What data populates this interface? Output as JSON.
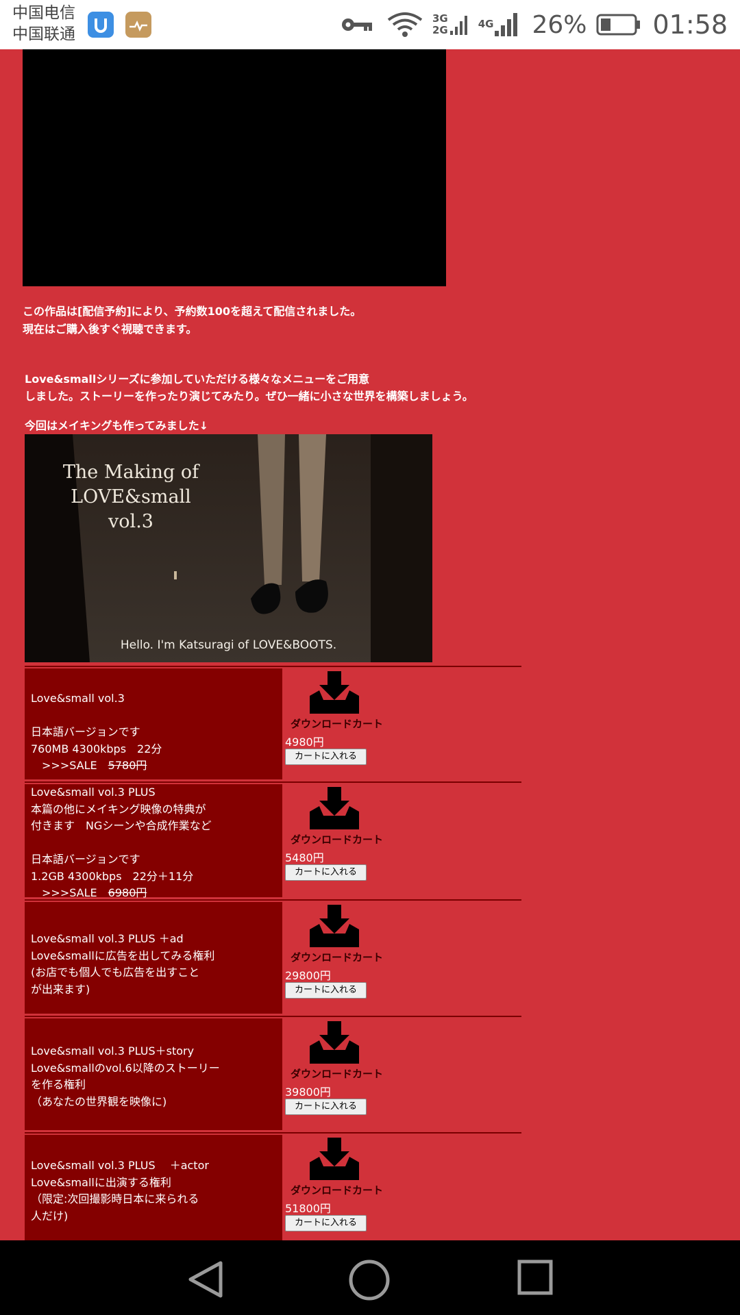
{
  "status_bar": {
    "carrier_1": "中国电信",
    "carrier_2": "中国联通",
    "net_1_top": "3G",
    "net_1_bottom": "2G",
    "net_2": "4G",
    "battery": "26%",
    "time": "01:58",
    "icons": [
      "app-icon-blue",
      "app-icon-gold",
      "key-icon",
      "wifi-icon",
      "signal-icon",
      "signal-icon",
      "battery-icon"
    ]
  },
  "notice": {
    "line1": "この作品は[配信予約]により、予約数100を超えて配信されました。",
    "line2": "現在はご購入後すぐ視聴できます。"
  },
  "intro": {
    "line1": "Love&smallシリーズに参加していただける様々なメニューをご用意",
    "line2": "しました。ストーリーを作ったり演じてみたり。ぜひ一緒に小さな世界を構築しましょう。"
  },
  "making_line": "今回はメイキングも作ってみました↓",
  "hero": {
    "title_1": "The Making of",
    "title_2": "LOVE&small",
    "title_3": "vol.3",
    "caption": "Hello. I'm Katsuragi of LOVE&BOOTS."
  },
  "products": [
    {
      "lines": [
        "Love&small vol.3",
        "",
        "日本語バージョンです",
        "760MB 4300kbps　22分"
      ],
      "sale_prefix": "　>>>SALE　",
      "sale_old": "5780円",
      "download_label": "ダウンロードカート",
      "price": "4980円",
      "button": "カートに入れる"
    },
    {
      "lines": [
        "Love&small vol.3 PLUS",
        "本篇の他にメイキング映像の特典が",
        "付きます　NGシーンや合成作業など",
        "",
        "日本語バージョンです",
        "1.2GB 4300kbps　22分＋11分"
      ],
      "sale_prefix": "　>>>SALE　",
      "sale_old": "6980円",
      "download_label": "ダウンロードカート",
      "price": "5480円",
      "button": "カートに入れる"
    },
    {
      "lines": [
        "Love&small vol.3 PLUS ＋ad",
        "Love&smallに広告を出してみる権利",
        "(お店でも個人でも広告を出すこと",
        "が出来ます)"
      ],
      "download_label": "ダウンロードカート",
      "price": "29800円",
      "button": "カートに入れる"
    },
    {
      "lines": [
        "Love&small vol.3 PLUS＋story",
        "Love&smallのvol.6以降のストーリー",
        "を作る権利",
        "（あなたの世界観を映像に)"
      ],
      "download_label": "ダウンロードカート",
      "price": "39800円",
      "button": "カートに入れる"
    },
    {
      "lines": [
        "Love&small vol.3 PLUS　 ＋actor",
        "Love&smallに出演する権利",
        "（限定:次回撮影時日本に来られる",
        "人だけ)"
      ],
      "download_label": "ダウンロードカート",
      "price": "51800円",
      "button": "カートに入れる"
    }
  ],
  "nav": {
    "icons": [
      "back-icon",
      "home-icon",
      "recents-icon"
    ]
  },
  "colors": {
    "page_bg": "#d1323a",
    "product_cell_bg": "#840000",
    "divider": "#7a0000"
  }
}
